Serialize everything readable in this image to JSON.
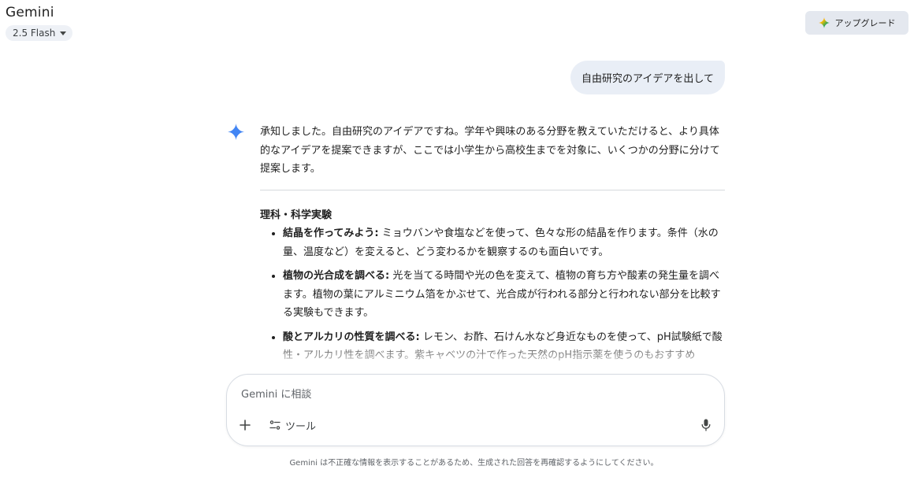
{
  "header": {
    "title": "Gemini",
    "model": "2.5 Flash",
    "upgrade_label": "アップグレード"
  },
  "conversation": {
    "user_message": "自由研究のアイデアを出して",
    "response": {
      "intro": "承知しました。自由研究のアイデアですね。学年や興味のある分野を教えていただけると、より具体的なアイデアを提案できますが、ここでは小学生から高校生までを対象に、いくつかの分野に分けて提案します。",
      "section_title": "理科・科学実験",
      "items": [
        {
          "title": "結晶を作ってみよう:",
          "text": " ミョウバンや食塩などを使って、色々な形の結晶を作ります。条件（水の量、温度など）を変えると、どう変わるかを観察するのも面白いです。"
        },
        {
          "title": "植物の光合成を調べる:",
          "text": " 光を当てる時間や光の色を変えて、植物の育ち方や酸素の発生量を調べます。植物の葉にアルミニウム箔をかぶせて、光合成が行われる部分と行われない部分を比較する実験もできます。"
        },
        {
          "title": "酸とアルカリの性質を調べる:",
          "text": " レモン、お酢、石けん水など身近なものを使って、pH試験紙で酸性・アルカリ性を調べます。紫キャベツの汁で作った天然のpH指示薬を使うのもおすすめ"
        }
      ]
    }
  },
  "composer": {
    "placeholder": "Gemini に相談",
    "tools_label": "ツール"
  },
  "footer": {
    "disclaimer": "Gemini は不正確な情報を表示することがあるため、生成された回答を再確認するようにしてください。"
  },
  "colors": {
    "accent_blue": "#4285f4",
    "bubble_bg": "#e9eef6",
    "upgrade_bg": "#e4e8ef"
  }
}
